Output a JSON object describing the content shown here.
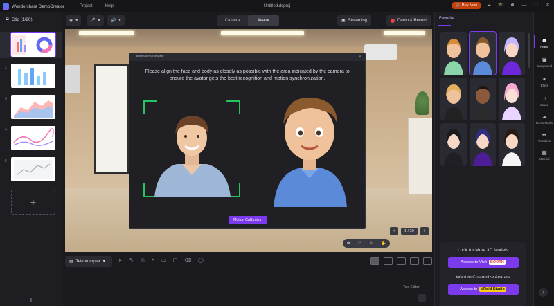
{
  "titlebar": {
    "app_name": "Wondershare DemoCreator",
    "menu": [
      "Project",
      "Help"
    ],
    "document_title": "Untitled.dcproj",
    "buy_now": "Buy Now"
  },
  "clips": {
    "header": "Clip (1/20)",
    "items": [
      {
        "num": "1"
      },
      {
        "num": "2"
      },
      {
        "num": "3"
      },
      {
        "num": "4"
      },
      {
        "num": "5"
      }
    ],
    "add_symbol": "+",
    "footer_add": "+"
  },
  "toolbar": {
    "mode_camera": "Camera",
    "mode_avatar": "Avatar",
    "streaming": "Streaming",
    "demo_record": "Demo & Record"
  },
  "modal": {
    "title": "Calibrate the avatar",
    "message": "Please align the face and body as closely as possible with the area indicated by the camera to ensure  the avatar gets the best recognition and motion synchronization.",
    "button": "Motion Calibration"
  },
  "stage": {
    "page": "1 / 20"
  },
  "bottom": {
    "teleprompter": "Teleprompter",
    "text_editor": "Text Editor",
    "t_icon": "T"
  },
  "right_panel": {
    "tab": "Favorite",
    "promo1_title": "Look for More 3D Models",
    "promo1_button": "Access to Visit",
    "promo1_badge": "BOOTH",
    "promo2_title": "Want to Customize Avatars",
    "promo2_button": "Access to",
    "promo2_badge": "VRoid Studio"
  },
  "rail": {
    "items": [
      "Avatar",
      "Background",
      "Effect",
      "Sound",
      "Demo Media",
      "Transition",
      "Material"
    ]
  },
  "colors": {
    "accent": "#7c3aed",
    "guide": "#22c55e",
    "record": "#ef4444"
  }
}
